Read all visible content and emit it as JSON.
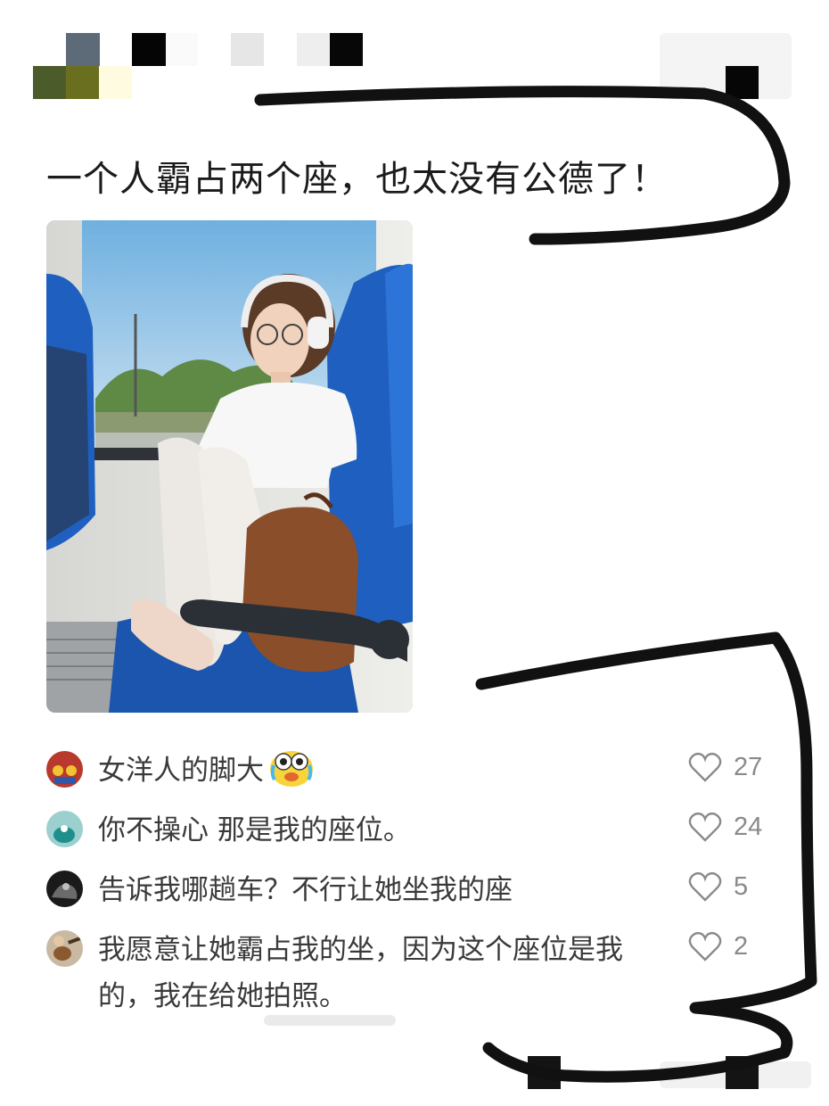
{
  "post": {
    "title": "一个人霸占两个座，也太没有公德了！"
  },
  "comments": [
    {
      "avatar": "red-cartoon-avatar",
      "text": "女洋人的脚大",
      "emoji": "crying-laughing-emoji",
      "likes": "27"
    },
    {
      "avatar": "teal-cartoon-avatar",
      "text": "你不操心 那是我的座位。",
      "likes": "24"
    },
    {
      "avatar": "dark-photo-avatar",
      "text": "告诉我哪趟车？不行让她坐我的座",
      "likes": "5"
    },
    {
      "avatar": "guitar-photo-avatar",
      "text": "我愿意让她霸占我的坐，因为这个座位是我的，我在给她拍照。",
      "likes": "2"
    }
  ],
  "colors": {
    "seat_blue": "#1f5fbf",
    "scribble": "#111111",
    "like_gray": "#8a8a8a"
  }
}
